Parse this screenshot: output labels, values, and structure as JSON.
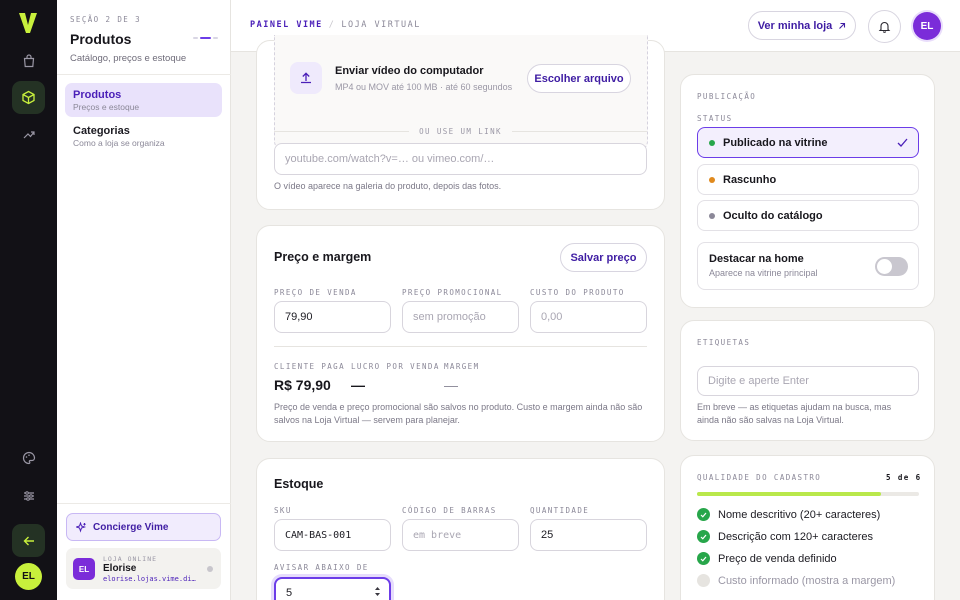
{
  "rail": {
    "logo": "V",
    "user_initials": "EL",
    "icons": [
      "bag-icon",
      "box-icon",
      "trend-icon",
      "palette-icon",
      "sliders-icon",
      "back-arrow-icon"
    ]
  },
  "sidebar": {
    "eyebrow": "SEÇÃO 2 DE 3",
    "title": "Produtos",
    "subtitle": "Catálogo, preços e estoque",
    "items": [
      {
        "label": "Produtos",
        "sub": "Preços e estoque"
      },
      {
        "label": "Categorias",
        "sub": "Como a loja se organiza"
      }
    ],
    "concierge": "Concierge Vime",
    "store": {
      "initials": "EL",
      "eyebrow": "LOJA ONLINE",
      "name": "Elorise",
      "url": "elorise.lojas.vime.di…"
    }
  },
  "topbar": {
    "crumb_1": "PAINEL VIME",
    "crumb_sep": "/",
    "crumb_2": "LOJA VIRTUAL",
    "view_store": "Ver minha loja",
    "user_initials": "EL"
  },
  "video": {
    "upload_title": "Enviar vídeo do computador",
    "upload_sub": "MP4 ou MOV até 100 MB · até 60 segundos",
    "choose_file": "Escolher arquivo",
    "or_link": "OU USE UM LINK",
    "link_placeholder": "youtube.com/watch?v=… ou vimeo.com/…",
    "help": "O vídeo aparece na galeria do produto, depois das fotos."
  },
  "price": {
    "title": "Preço e margem",
    "save": "Salvar preço",
    "sale_label": "PREÇO DE VENDA",
    "sale_value": "79,90",
    "promo_label": "PREÇO PROMOCIONAL",
    "promo_placeholder": "sem promoção",
    "cost_label": "CUSTO DO PRODUTO",
    "cost_placeholder": "0,00",
    "client_label": "CLIENTE PAGA",
    "client_value": "R$ 79,90",
    "profit_label": "LUCRO POR VENDA",
    "profit_value": "—",
    "margin_label": "MARGEM",
    "margin_value": "—",
    "help": "Preço de venda e preço promocional são salvos no produto. Custo e margem ainda não são salvos na Loja Virtual — servem para planejar."
  },
  "stock": {
    "title": "Estoque",
    "sku_label": "SKU",
    "sku_value": "CAM-BAS-001",
    "barcode_label": "CÓDIGO DE BARRAS",
    "barcode_placeholder": "em breve",
    "qty_label": "QUANTIDADE",
    "qty_value": "25",
    "alert_label": "AVISAR ABAIXO DE",
    "alert_value": "5"
  },
  "publication": {
    "eyebrow": "PUBLICAÇÃO",
    "status_label": "STATUS",
    "options": [
      {
        "label": "Publicado na vitrine",
        "color": "#27a64a"
      },
      {
        "label": "Rascunho",
        "color": "#e08a1e"
      },
      {
        "label": "Oculto do catálogo",
        "color": "#8b8898"
      }
    ],
    "highlight_title": "Destacar na home",
    "highlight_sub": "Aparece na vitrine principal"
  },
  "tags": {
    "eyebrow": "ETIQUETAS",
    "placeholder": "Digite e aperte Enter",
    "help": "Em breve — as etiquetas ajudam na busca, mas ainda não são salvas na Loja Virtual."
  },
  "quality": {
    "eyebrow": "QUALIDADE DO CADASTRO",
    "score": "5 de 6",
    "progress": 0.83,
    "items": [
      {
        "label": "Nome descritivo (20+ caracteres)",
        "done": true
      },
      {
        "label": "Descrição com 120+ caracteres",
        "done": true
      },
      {
        "label": "Preço de venda definido",
        "done": true
      },
      {
        "label": "Custo informado (mostra a margem)",
        "done": false
      }
    ]
  },
  "colors": {
    "accent": "#6c3de8",
    "brand_green": "#c8f03c",
    "success": "#27a64a"
  }
}
